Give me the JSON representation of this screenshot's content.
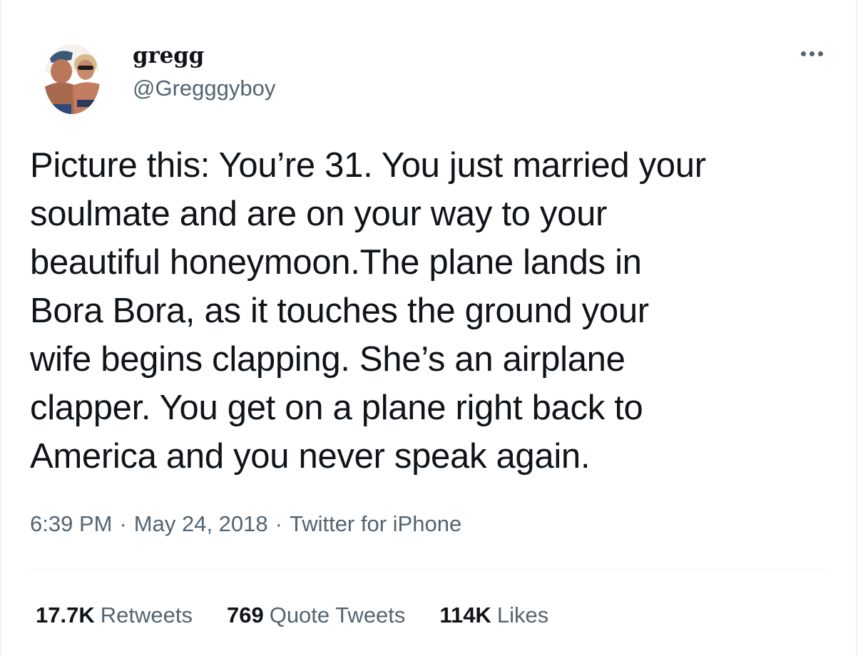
{
  "author": {
    "display_name": "gregg",
    "handle": "@Gregggyboy"
  },
  "tweet": {
    "text": "Picture this: You’re 31. You just married your\nsoulmate and are on your way to your\nbeautiful honeymoon.The plane lands in\nBora Bora, as it touches the ground your\nwife begins clapping. She’s an airplane\nclapper. You get on a plane right back to\nAmerica and you never speak again.",
    "time": "6:39 PM",
    "separator": "·",
    "date": "May 24, 2018",
    "source": "Twitter for iPhone"
  },
  "stats": [
    {
      "count": "17.7K",
      "label": "Retweets"
    },
    {
      "count": "769",
      "label": "Quote Tweets"
    },
    {
      "count": "114K",
      "label": "Likes"
    }
  ],
  "icons": {
    "more": "more-horizontal-icon",
    "avatar": "profile-photo"
  },
  "colors": {
    "text_primary": "#0f1419",
    "text_secondary": "#536471",
    "divider": "#eff3f4",
    "background": "#ffffff"
  }
}
